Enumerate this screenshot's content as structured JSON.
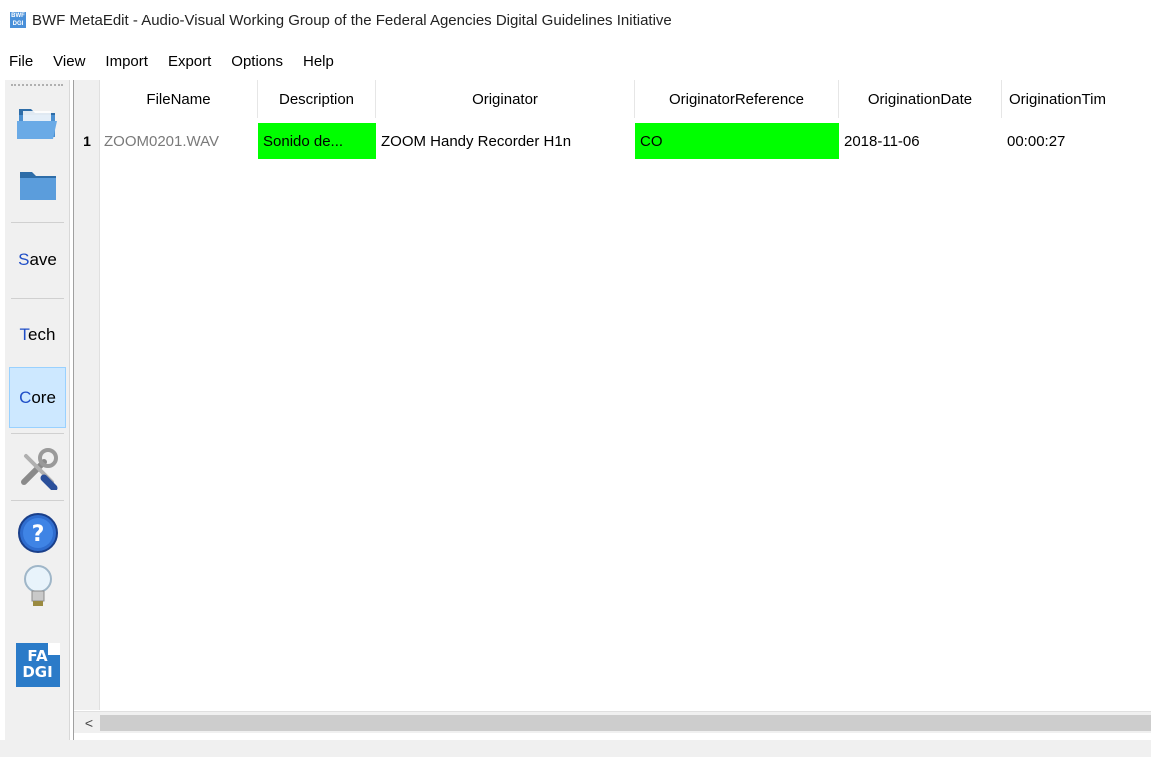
{
  "window": {
    "icon_text": "BWF DGI",
    "title": "BWF MetaEdit - Audio-Visual Working Group of the Federal Agencies Digital Guidelines Initiative"
  },
  "menu": [
    "File",
    "View",
    "Import",
    "Export",
    "Options",
    "Help"
  ],
  "toolbar": {
    "save": {
      "hot": "S",
      "rest": "ave"
    },
    "tech": {
      "hot": "T",
      "rest": "ech"
    },
    "core": {
      "hot": "C",
      "rest": "ore"
    },
    "fadgi_top": "FA",
    "fadgi_bottom": "DGI"
  },
  "table": {
    "columns": [
      "FileName",
      "Description",
      "Originator",
      "OriginatorReference",
      "OriginationDate",
      "OriginationTim"
    ],
    "rows": [
      {
        "num": "1",
        "cells": [
          "ZOOM0201.WAV",
          "Sonido de...",
          "ZOOM Handy Recorder H1n",
          "CO",
          "2018-11-06",
          "00:00:27"
        ]
      }
    ]
  },
  "scroll": {
    "left_arrow": "<"
  },
  "colors": {
    "highlight": "#00ff00",
    "toolbar_bg": "#f0f0f0",
    "accent": "#1f4ec7"
  }
}
